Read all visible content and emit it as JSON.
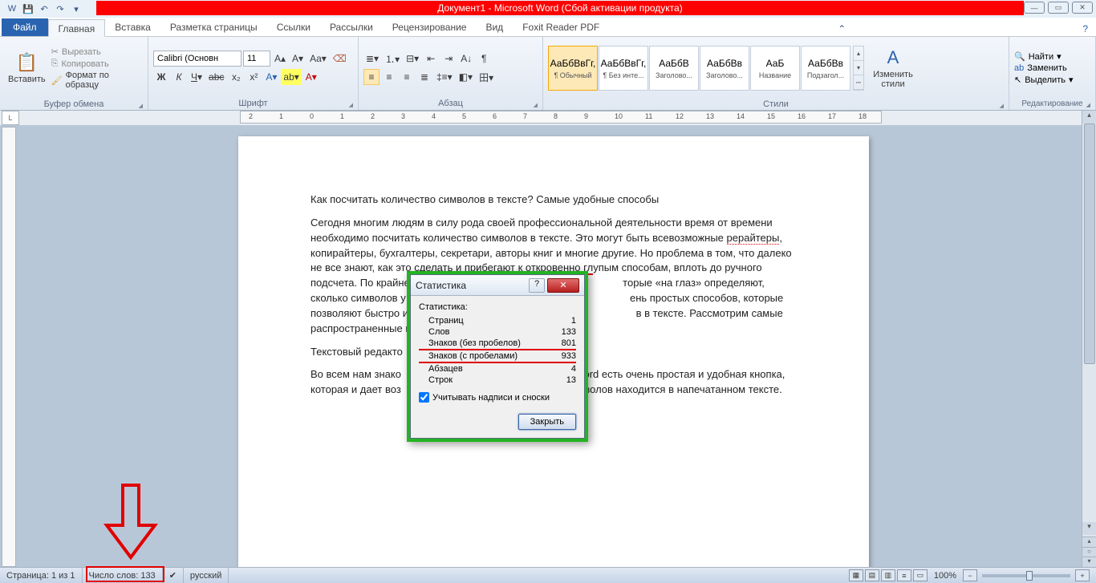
{
  "window": {
    "title": "Документ1 - Microsoft Word (Сбой активации продукта)"
  },
  "tabs": {
    "file": "Файл",
    "items": [
      "Главная",
      "Вставка",
      "Разметка страницы",
      "Ссылки",
      "Рассылки",
      "Рецензирование",
      "Вид",
      "Foxit Reader PDF"
    ]
  },
  "clipboard": {
    "paste": "Вставить",
    "cut": "Вырезать",
    "copy": "Копировать",
    "format_painter": "Формат по образцу",
    "label": "Буфер обмена"
  },
  "font": {
    "name": "Calibri (Основн",
    "size": "11",
    "label": "Шрифт"
  },
  "paragraph": {
    "label": "Абзац"
  },
  "styles": {
    "items": [
      {
        "prev": "АаБбВвГг,",
        "lbl": "¶ Обычный",
        "sel": true
      },
      {
        "prev": "АаБбВвГг,",
        "lbl": "¶ Без инте..."
      },
      {
        "prev": "АаБбВ",
        "lbl": "Заголово..."
      },
      {
        "prev": "АаБбВв",
        "lbl": "Заголово..."
      },
      {
        "prev": "АаБ",
        "lbl": "Название"
      },
      {
        "prev": "АаБбВв",
        "lbl": "Подзагол..."
      }
    ],
    "change": "Изменить\nстили",
    "label": "Стили"
  },
  "editing": {
    "find": "Найти",
    "replace": "Заменить",
    "select": "Выделить",
    "label": "Редактирование"
  },
  "doc": {
    "h1": "Как посчитать количество символов в тексте? Самые удобные способы",
    "p1a": "Сегодня многим людям в силу рода своей профессиональной деятельности время от времени необходимо посчитать количество символов в тексте. Это могут быть всевозможные ",
    "p1_r": "рерайтеры",
    "p1b": ", копирайтеры, бухгалтеры, секретари, авторы книг и многие другие. Но проблема в том, что далеко не все знают, как это ",
    "p1_hl": "сделать и прибегают к откровенно гл",
    "p1c": "упым способам, вплоть до ручного подсчета. По крайней мере, н",
    "p1d": "торые «на глаз» определяют, сколько символов у них в те",
    "p1e": "ень простых способов, которые позволяют быстро и без особ",
    "p1f": "в в тексте. Рассмотрим самые распространенные и",
    "p2": "Текстовый редакто",
    "p3a": "Во всем нам знако",
    "p3b": "ord есть очень простая и удобная кнопка, которая и дает воз",
    "p3c": "символов находится в напечатанном тексте."
  },
  "dialog": {
    "title": "Статистика",
    "heading": "Статистика:",
    "rows": [
      {
        "k": "Страниц",
        "v": "1"
      },
      {
        "k": "Слов",
        "v": "133"
      },
      {
        "k": "Знаков (без пробелов)",
        "v": "801",
        "hl": true
      },
      {
        "k": "Знаков (с пробелами)",
        "v": "933",
        "hl": true
      },
      {
        "k": "Абзацев",
        "v": "4"
      },
      {
        "k": "Строк",
        "v": "13"
      }
    ],
    "checkbox": "Учитывать надписи и сноски",
    "close": "Закрыть"
  },
  "status": {
    "page": "Страница: 1 из 1",
    "words": "Число слов: 133",
    "lang": "русский",
    "zoom": "100%"
  }
}
